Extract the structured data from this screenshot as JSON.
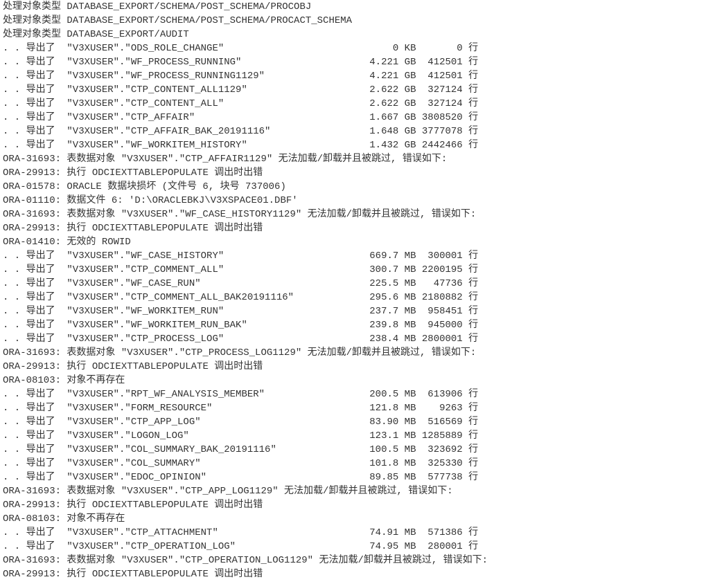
{
  "header_lines": [
    "处理对象类型 DATABASE_EXPORT/SCHEMA/POST_SCHEMA/PROCOBJ",
    "处理对象类型 DATABASE_EXPORT/SCHEMA/POST_SCHEMA/PROCACT_SCHEMA",
    "处理对象类型 DATABASE_EXPORT/AUDIT"
  ],
  "export_label": "导出了",
  "row_prefix": ". . ",
  "rows_suffix": "行",
  "exports_a": [
    {
      "object": "\"V3XUSER\".\"ODS_ROLE_CHANGE\"",
      "size": "0 KB",
      "rows": "0"
    },
    {
      "object": "\"V3XUSER\".\"WF_PROCESS_RUNNING\"",
      "size": "4.221 GB",
      "rows": "412501"
    },
    {
      "object": "\"V3XUSER\".\"WF_PROCESS_RUNNING1129\"",
      "size": "4.221 GB",
      "rows": "412501"
    },
    {
      "object": "\"V3XUSER\".\"CTP_CONTENT_ALL1129\"",
      "size": "2.622 GB",
      "rows": "327124"
    },
    {
      "object": "\"V3XUSER\".\"CTP_CONTENT_ALL\"",
      "size": "2.622 GB",
      "rows": "327124"
    },
    {
      "object": "\"V3XUSER\".\"CTP_AFFAIR\"",
      "size": "1.667 GB",
      "rows": "3808520"
    },
    {
      "object": "\"V3XUSER\".\"CTP_AFFAIR_BAK_20191116\"",
      "size": "1.648 GB",
      "rows": "3777078"
    },
    {
      "object": "\"V3XUSER\".\"WF_WORKITEM_HISTORY\"",
      "size": "1.432 GB",
      "rows": "2442466"
    }
  ],
  "errors_a": [
    "ORA-31693: 表数据对象 \"V3XUSER\".\"CTP_AFFAIR1129\" 无法加载/卸载并且被跳过, 错误如下:",
    "ORA-29913: 执行 ODCIEXTTABLEPOPULATE 调出时出错",
    "ORA-01578: ORACLE 数据块损坏 (文件号 6, 块号 737006)",
    "ORA-01110: 数据文件 6: 'D:\\ORACLEBKJ\\V3XSPACE01.DBF'",
    "ORA-31693: 表数据对象 \"V3XUSER\".\"WF_CASE_HISTORY1129\" 无法加载/卸载并且被跳过, 错误如下:",
    "ORA-29913: 执行 ODCIEXTTABLEPOPULATE 调出时出错",
    "ORA-01410: 无效的 ROWID"
  ],
  "exports_b": [
    {
      "object": "\"V3XUSER\".\"WF_CASE_HISTORY\"",
      "size": "669.7 MB",
      "rows": "300001"
    },
    {
      "object": "\"V3XUSER\".\"CTP_COMMENT_ALL\"",
      "size": "300.7 MB",
      "rows": "2200195"
    },
    {
      "object": "\"V3XUSER\".\"WF_CASE_RUN\"",
      "size": "225.5 MB",
      "rows": "47736"
    },
    {
      "object": "\"V3XUSER\".\"CTP_COMMENT_ALL_BAK20191116\"",
      "size": "295.6 MB",
      "rows": "2180882"
    },
    {
      "object": "\"V3XUSER\".\"WF_WORKITEM_RUN\"",
      "size": "237.7 MB",
      "rows": "958451"
    },
    {
      "object": "\"V3XUSER\".\"WF_WORKITEM_RUN_BAK\"",
      "size": "239.8 MB",
      "rows": "945000"
    },
    {
      "object": "\"V3XUSER\".\"CTP_PROCESS_LOG\"",
      "size": "238.4 MB",
      "rows": "2800001"
    }
  ],
  "errors_b": [
    "ORA-31693: 表数据对象 \"V3XUSER\".\"CTP_PROCESS_LOG1129\" 无法加载/卸载并且被跳过, 错误如下:",
    "ORA-29913: 执行 ODCIEXTTABLEPOPULATE 调出时出错",
    "ORA-08103: 对象不再存在"
  ],
  "exports_c": [
    {
      "object": "\"V3XUSER\".\"RPT_WF_ANALYSIS_MEMBER\"",
      "size": "200.5 MB",
      "rows": "613906"
    },
    {
      "object": "\"V3XUSER\".\"FORM_RESOURCE\"",
      "size": "121.8 MB",
      "rows": "9263"
    },
    {
      "object": "\"V3XUSER\".\"CTP_APP_LOG\"",
      "size": "83.90 MB",
      "rows": "516569"
    },
    {
      "object": "\"V3XUSER\".\"LOGON_LOG\"",
      "size": "123.1 MB",
      "rows": "1285889"
    },
    {
      "object": "\"V3XUSER\".\"COL_SUMMARY_BAK_20191116\"",
      "size": "100.5 MB",
      "rows": "323692"
    },
    {
      "object": "\"V3XUSER\".\"COL_SUMMARY\"",
      "size": "101.8 MB",
      "rows": "325330"
    },
    {
      "object": "\"V3XUSER\".\"EDOC_OPINION\"",
      "size": "89.85 MB",
      "rows": "577738"
    }
  ],
  "errors_c": [
    "ORA-31693: 表数据对象 \"V3XUSER\".\"CTP_APP_LOG1129\" 无法加载/卸载并且被跳过, 错误如下:",
    "ORA-29913: 执行 ODCIEXTTABLEPOPULATE 调出时出错",
    "ORA-08103: 对象不再存在"
  ],
  "exports_d": [
    {
      "object": "\"V3XUSER\".\"CTP_ATTACHMENT\"",
      "size": "74.91 MB",
      "rows": "571386"
    },
    {
      "object": "\"V3XUSER\".\"CTP_OPERATION_LOG\"",
      "size": "74.95 MB",
      "rows": "280001"
    }
  ],
  "errors_d": [
    "ORA-31693: 表数据对象 \"V3XUSER\".\"CTP_OPERATION_LOG1129\" 无法加载/卸载并且被跳过, 错误如下:",
    "ORA-29913: 执行 ODCIEXTTABLEPOPULATE 调出时出错"
  ],
  "layout": {
    "col_object_width": 48,
    "col_size_width": 12,
    "col_rows_width": 8
  }
}
